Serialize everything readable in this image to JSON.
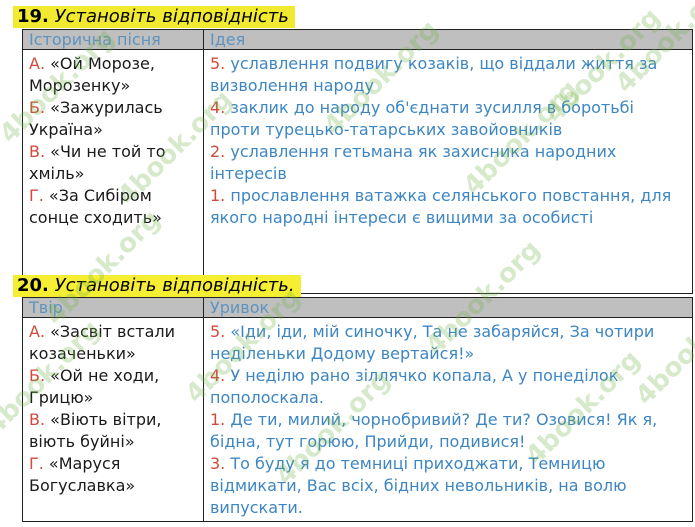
{
  "task19": {
    "number": "19.",
    "title": "Установіть відповідність",
    "col_left": "Історична пісня",
    "col_right": "Ідея",
    "left_items": [
      {
        "letter": "А.",
        "text": " «Ой Морозе, Морозенку»"
      },
      {
        "letter": "Б.",
        "text": " «Зажурилась Україна»"
      },
      {
        "letter": "В.",
        "text": " «Чи не той то хміль»"
      },
      {
        "letter": "Г.",
        "text": " «За Сибіром сонце сходить»"
      }
    ],
    "right_items": [
      {
        "num": "5.",
        "text": " уславлення подвигу козаків, що віддали життя за визволення народу"
      },
      {
        "num": "4.",
        "text": " заклик до народу об'єднати зусилля в боротьбі проти турецько-татарських завойовників"
      },
      {
        "num": "2.",
        "text": " уславлення гетьмана як захисника народних інтересів"
      },
      {
        "num": "1.",
        "text": " прославлення ватажка селянського повстання, для якого народні інтереси є вищими за особисті"
      }
    ]
  },
  "task20": {
    "number": "20.",
    "title": "Установіть відповідність.",
    "col_left": "Твір",
    "col_right": "Уривок",
    "left_items": [
      {
        "letter": "А.",
        "text": " «Засвіт встали козаченьки»"
      },
      {
        "letter": "Б.",
        "text": " «Ой не ходи, Грицю»"
      },
      {
        "letter": "В.",
        "text": " «Віють вітри, віють буйні»"
      },
      {
        "letter": "Г.",
        "text": " «Маруся Богуславка»"
      }
    ],
    "right_items": [
      {
        "num": "5.",
        "text": " «Іди, іди, мій синочку, Та не забаряйся, За чотири неділеньки Додому вертайся!»"
      },
      {
        "num": "4.",
        "text": " У неділю рано зіллячко копала, А у понеділок пополоскала."
      },
      {
        "num": "1.",
        "text": " Де ти, милий, чорнобривий? Де ти? Озовися! Як я, бідна, тут горюю, Прийди, подивися!"
      },
      {
        "num": "3.",
        "text": " То буду я до темниці приходжати, Темницю відмикати, Вас всіх, бідних невольників, на волю випускати."
      }
    ]
  },
  "watermark": "4book.org"
}
